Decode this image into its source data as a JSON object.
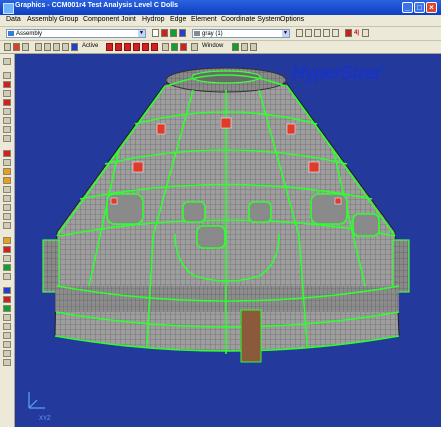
{
  "window": {
    "title": "Graphics - CCM001r4 Test Analysis Level C Dolls",
    "controls": {
      "minimize": "_",
      "maximize": "□",
      "close": "×"
    }
  },
  "menu": {
    "items": [
      "Data",
      "Assembly",
      "Group",
      "Component",
      "Joint",
      "Hydrop",
      "Edge",
      "Element",
      "Coordinate System",
      "Options"
    ]
  },
  "toolbar1": {
    "assembly_select": "Assembly",
    "color_select": "gray (1)",
    "marks": "4|"
  },
  "toolbar2": {
    "active_label": "Active",
    "window_label": "Window"
  },
  "branding": {
    "logo": "HyperSizer",
    "trademark": "®"
  },
  "axes_triad": "XYZ",
  "colors": {
    "background": "#233a9c",
    "mesh": "#9a9a9a",
    "highlight": "#2eff2e",
    "feature": "#e03a2a",
    "logo": "#1832c8"
  }
}
